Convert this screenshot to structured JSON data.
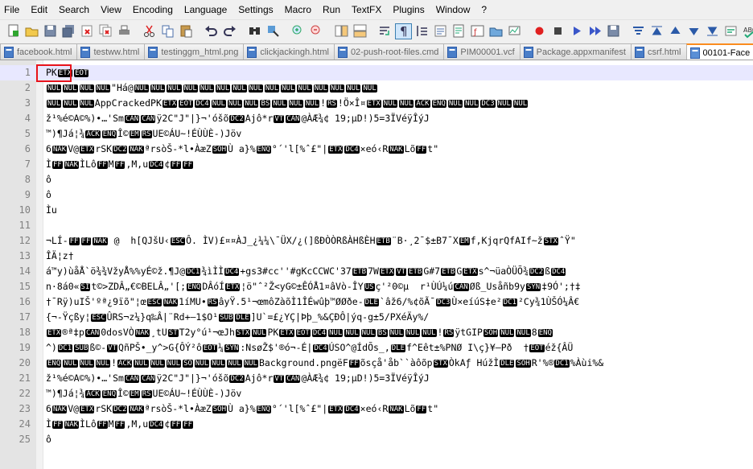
{
  "menu": [
    "File",
    "Edit",
    "Search",
    "View",
    "Encoding",
    "Language",
    "Settings",
    "Macro",
    "Run",
    "TextFX",
    "Plugins",
    "Window",
    "?"
  ],
  "toolbar_icons": [
    "new-file-icon",
    "open-file-icon",
    "save-icon",
    "save-all-icon",
    "close-icon",
    "close-all-icon",
    "print-icon",
    "cut-icon",
    "copy-icon",
    "paste-icon",
    "undo-icon",
    "redo-icon",
    "find-icon",
    "replace-icon",
    "zoom-in-icon",
    "zoom-out-icon",
    "sync-vertical-icon",
    "sync-horizontal-icon",
    "word-wrap-icon",
    "show-all-chars-icon",
    "indent-guide-icon",
    "user-lang-icon",
    "doc-map-icon",
    "function-list-icon",
    "folder-workspace-icon",
    "monitoring-icon",
    "record-macro-icon",
    "stop-macro-icon",
    "play-macro-icon",
    "run-macro-multiple-icon",
    "save-macro-icon",
    "trim-icon",
    "collapse-icon",
    "move-up-icon",
    "move-down-icon",
    "expand-icon",
    "select-icon",
    "spell-check-icon"
  ],
  "tabs": [
    {
      "label": "facebook.html"
    },
    {
      "label": "testww.html"
    },
    {
      "label": "testinggm_html.png"
    },
    {
      "label": "clickjackingh.html"
    },
    {
      "label": "02-push-root-files.cmd"
    },
    {
      "label": "PIM00001.vcf"
    },
    {
      "label": "Package.appxmanifest"
    },
    {
      "label": "csrf.html"
    },
    {
      "label": "00101-Face"
    }
  ],
  "active_tab": 8,
  "lines": [
    [
      [
        "t",
        "PK"
      ],
      [
        "c",
        "ETX"
      ],
      [
        "c",
        "EOT"
      ]
    ],
    [
      [
        "c",
        "NUL"
      ],
      [
        "c",
        "NUL"
      ],
      [
        "c",
        "NUL"
      ],
      [
        "c",
        "NUL"
      ],
      [
        "t",
        "\"Há@"
      ],
      [
        "c",
        "NUL"
      ],
      [
        "c",
        "NUL"
      ],
      [
        "c",
        "NUL"
      ],
      [
        "c",
        "NUL"
      ],
      [
        "c",
        "NUL"
      ],
      [
        "c",
        "NUL"
      ],
      [
        "c",
        "NUL"
      ],
      [
        "c",
        "NUL"
      ],
      [
        "c",
        "NUL"
      ],
      [
        "c",
        "NUL"
      ],
      [
        "c",
        "NUL"
      ],
      [
        "c",
        "NUL"
      ],
      [
        "c",
        "NUL"
      ],
      [
        "c",
        "NUL"
      ],
      [
        "c",
        "NUL"
      ]
    ],
    [
      [
        "c",
        "NUL"
      ],
      [
        "c",
        "NUL"
      ],
      [
        "c",
        "NUL"
      ],
      [
        "t",
        "AppCrackedPK"
      ],
      [
        "c",
        "ETX"
      ],
      [
        "c",
        "EOT"
      ],
      [
        "c",
        "DC4"
      ],
      [
        "c",
        "NUL"
      ],
      [
        "c",
        "NUL"
      ],
      [
        "c",
        "NUL"
      ],
      [
        "c",
        "BS"
      ],
      [
        "c",
        "NUL"
      ],
      [
        "c",
        "NUL"
      ],
      [
        "c",
        "NUL"
      ],
      [
        "t",
        "!"
      ],
      [
        "c",
        "RS"
      ],
      [
        "t",
        "!Ö×Î¤"
      ],
      [
        "c",
        "ETX"
      ],
      [
        "c",
        "NUL"
      ],
      [
        "c",
        "NUL"
      ],
      [
        "c",
        "ACK"
      ],
      [
        "c",
        "ENQ"
      ],
      [
        "c",
        "NUL"
      ],
      [
        "c",
        "NUL"
      ],
      [
        "c",
        "DC3"
      ],
      [
        "c",
        "NUL"
      ],
      [
        "c",
        "NUL"
      ]
    ],
    [
      [
        "t",
        "ž¹%é©A©%)•…'Sm"
      ],
      [
        "c",
        "CAN"
      ],
      [
        "c",
        "CAN"
      ],
      [
        "t",
        "ÿ2C\"J\"|}¬'óšõ"
      ],
      [
        "c",
        "DC2"
      ],
      [
        "t",
        "Ajô*r"
      ],
      [
        "c",
        "VT"
      ],
      [
        "c",
        "CAN"
      ],
      [
        "t",
        "@ÀÆ¾¢ 19;µD!)5=3ÏVéÿÎýJ"
      ]
    ],
    [
      [
        "t",
        "™)¶Já¦¾"
      ],
      [
        "c",
        "ACK"
      ],
      [
        "c",
        "ENQ"
      ],
      [
        "t",
        "Î©"
      ],
      [
        "c",
        "EM"
      ],
      [
        "c",
        "RS"
      ],
      [
        "t",
        "UE©ÁU~!ÉÙÙÈ-)Jöv"
      ]
    ],
    [
      [
        "t",
        "6"
      ],
      [
        "c",
        "NAK"
      ],
      [
        "t",
        "V@"
      ],
      [
        "c",
        "ETX"
      ],
      [
        "t",
        "rSK"
      ],
      [
        "c",
        "DC2"
      ],
      [
        "c",
        "NAK"
      ],
      [
        "t",
        "ªrsòŠ-*l•ÀæZ"
      ],
      [
        "c",
        "SOH"
      ],
      [
        "t",
        "Ù a}%"
      ],
      [
        "c",
        "ENQ"
      ],
      [
        "t",
        "°´'l[%ˆ£\"|"
      ],
      [
        "c",
        "ETX"
      ],
      [
        "c",
        "DC4"
      ],
      [
        "t",
        "×eó‹R"
      ],
      [
        "c",
        "NAK"
      ],
      [
        "t",
        "Lõ"
      ],
      [
        "c",
        "FF"
      ],
      [
        "t",
        "t\""
      ]
    ],
    [
      [
        "t",
        "Ì"
      ],
      [
        "c",
        "FF"
      ],
      [
        "c",
        "NAK"
      ],
      [
        "t",
        "ÌLô"
      ],
      [
        "c",
        "FF"
      ],
      [
        "t",
        "M"
      ],
      [
        "c",
        "FF"
      ],
      [
        "t",
        ",M,u"
      ],
      [
        "c",
        "DC4"
      ],
      [
        "t",
        "¢"
      ],
      [
        "c",
        "FF"
      ],
      [
        "c",
        "FF"
      ]
    ],
    [
      [
        "t",
        "ô"
      ]
    ],
    [
      [
        "t",
        "ô"
      ]
    ],
    [
      [
        "t",
        "Ìu"
      ]
    ],
    [],
    [
      [
        "t",
        "¬LÍ-"
      ],
      [
        "c",
        "FF"
      ],
      [
        "c",
        "FF"
      ],
      [
        "c",
        "NAK"
      ],
      [
        "t",
        " @  h[QJšU‹"
      ],
      [
        "c",
        "ESC"
      ],
      [
        "t",
        "Ô. ÌV)£¤¤ÀJ_¿¼¼\\¯ÜX/¿(]ßÐÒÒRßÀHßÈH"
      ],
      [
        "c",
        "ETB"
      ],
      [
        "t",
        "¨B·¸2¯$±B7¯X"
      ],
      [
        "c",
        "EM"
      ],
      [
        "t",
        "f,KjqrQfAIf~ž"
      ],
      [
        "c",
        "STX"
      ],
      [
        "t",
        "ˆŸ\""
      ]
    ],
    [
      [
        "t",
        "ÎÄ¦z†"
      ]
    ],
    [
      [
        "t",
        "á™y)ùåÅ`ö¾¾VžyÅ%%yÉ©ž.¶J@"
      ],
      [
        "c",
        "DC1"
      ],
      [
        "t",
        "¾ìÌÌ"
      ],
      [
        "c",
        "DC4"
      ],
      [
        "t",
        "+gs3#cc''#gKcCCWC'37"
      ],
      [
        "c",
        "ETB"
      ],
      [
        "t",
        "7W"
      ],
      [
        "c",
        "ETX"
      ],
      [
        "c",
        "VT"
      ],
      [
        "c",
        "ETB"
      ],
      [
        "t",
        "G#7"
      ],
      [
        "c",
        "ETB"
      ],
      [
        "t",
        "G"
      ],
      [
        "c",
        "ETX"
      ],
      [
        "t",
        "s^¬üaÒÜÕ¾"
      ],
      [
        "c",
        "DC2"
      ],
      [
        "t",
        "ß"
      ],
      [
        "c",
        "DC4"
      ]
    ],
    [
      [
        "t",
        "n·8á0«"
      ],
      [
        "c",
        "SI"
      ],
      [
        "t",
        "t©>ZDÂ„€©BELÂ„'[;"
      ],
      [
        "c",
        "ENQ"
      ],
      [
        "t",
        "DÂóÍ"
      ],
      [
        "c",
        "ETX"
      ],
      [
        "t",
        "¦ö\"ˆ²Ž<yG©±ÊÓÅ1¤âVò-ÎY"
      ],
      [
        "c",
        "US"
      ],
      [
        "t",
        "ç'²0©µ  r¹ÙÚ¼ú"
      ],
      [
        "c",
        "CAN"
      ],
      [
        "t",
        "Øß_Usåñb9y"
      ],
      [
        "c",
        "SYN"
      ],
      [
        "t",
        "‡9Ó';†‡"
      ]
    ],
    [
      [
        "t",
        "†¯Rÿ)uIŠ'ºª¿9ïõ\"¦œ"
      ],
      [
        "c",
        "ESC"
      ],
      [
        "c",
        "NAK"
      ],
      [
        "t",
        "1íMU•"
      ],
      [
        "c",
        "RS"
      ],
      [
        "t",
        "âyŸ.5¹¬œmôZàõÌ1ÎÉwûþ™ØØðe-"
      ],
      [
        "c",
        "DLE"
      ],
      [
        "t",
        "`âž6/%¢õÃ¯"
      ],
      [
        "c",
        "DC3"
      ],
      [
        "t",
        "Ù×eíúS‡e²"
      ],
      [
        "c",
        "DC1"
      ],
      [
        "t",
        "²Cy¾1ÙŠÓ¼Â€"
      ]
    ],
    [
      [
        "t",
        "{¬-Ÿçßy¦"
      ],
      [
        "c",
        "ESC"
      ],
      [
        "t",
        "ÛRS¬z¼}q‰Â|¨Rd+—1$O¹"
      ],
      [
        "c",
        "SUB"
      ],
      [
        "c",
        "DLE"
      ],
      [
        "t",
        "]U`=£¿YÇ|Þþ_%&ÇÐÔ|ýq-g±5/PXéÄy%/"
      ]
    ],
    [
      [
        "c",
        "ETX"
      ],
      [
        "t",
        "®ª‡p"
      ],
      [
        "c",
        "CAN"
      ],
      [
        "t",
        "0dosVÒ"
      ],
      [
        "c",
        "NAK"
      ],
      [
        "t",
        "¸tU"
      ],
      [
        "c",
        "ST"
      ],
      [
        "t",
        "T2y°ú¹¬œJh"
      ],
      [
        "c",
        "STX"
      ],
      [
        "c",
        "NUL"
      ],
      [
        "t",
        "PK"
      ],
      [
        "c",
        "ETX"
      ],
      [
        "c",
        "EOT"
      ],
      [
        "c",
        "DC4"
      ],
      [
        "c",
        "NUL"
      ],
      [
        "c",
        "NUL"
      ],
      [
        "c",
        "NUL"
      ],
      [
        "c",
        "BS"
      ],
      [
        "c",
        "NUL"
      ],
      [
        "c",
        "NUL"
      ],
      [
        "c",
        "NUL"
      ],
      [
        "t",
        "!"
      ],
      [
        "c",
        "RS"
      ],
      [
        "t",
        "ÿtGIP"
      ],
      [
        "c",
        "SOH"
      ],
      [
        "c",
        "NUL"
      ],
      [
        "c",
        "NUL"
      ],
      [
        "t",
        "8"
      ],
      [
        "c",
        "ENQ"
      ]
    ],
    [
      [
        "t",
        "^)"
      ],
      [
        "c",
        "DC1"
      ],
      [
        "c",
        "SUB"
      ],
      [
        "t",
        "ß©-"
      ],
      [
        "c",
        "VT"
      ],
      [
        "t",
        "QñPŠ•_y^>G{ÔÝ²ô"
      ],
      [
        "c",
        "EOT"
      ],
      [
        "t",
        "¼"
      ],
      [
        "c",
        "SYN"
      ],
      [
        "t",
        ":NsøŽ$'®ó¬-É|"
      ],
      [
        "c",
        "DC4"
      ],
      [
        "t",
        "ÚSO^@ÍdÕs_,"
      ],
      [
        "c",
        "DLE"
      ],
      [
        "t",
        "f^Eêt±%PNØ I\\ç}¥–Pð  †"
      ],
      [
        "c",
        "EOT"
      ],
      [
        "t",
        "éž{ÂÜ"
      ]
    ],
    [
      [
        "c",
        "ENQ"
      ],
      [
        "c",
        "NUL"
      ],
      [
        "c",
        "NUL"
      ],
      [
        "c",
        "NUL"
      ],
      [
        "t",
        "!"
      ],
      [
        "c",
        "ACK"
      ],
      [
        "c",
        "NUL"
      ],
      [
        "c",
        "NUL"
      ],
      [
        "c",
        "NUL"
      ],
      [
        "c",
        "SO"
      ],
      [
        "c",
        "NUL"
      ],
      [
        "c",
        "NUL"
      ],
      [
        "c",
        "NUL"
      ],
      [
        "c",
        "NUL"
      ],
      [
        "t",
        "Background.pngëF"
      ],
      [
        "c",
        "FF"
      ],
      [
        "t",
        "õsçå'åb``àôõp"
      ],
      [
        "c",
        "STX"
      ],
      [
        "t",
        "ÒkAƒ HúžÌ"
      ],
      [
        "c",
        "DLE"
      ],
      [
        "c",
        "SOH"
      ],
      [
        "t",
        "R'%®"
      ],
      [
        "c",
        "DC1"
      ],
      [
        "t",
        "%Àùi%&"
      ]
    ],
    [
      [
        "t",
        "ž¹%é©A©%)•…'Sm"
      ],
      [
        "c",
        "CAN"
      ],
      [
        "c",
        "CAN"
      ],
      [
        "t",
        "ÿ2C\"J\"|}¬'óšõ"
      ],
      [
        "c",
        "DC2"
      ],
      [
        "t",
        "Ajô*r"
      ],
      [
        "c",
        "VT"
      ],
      [
        "c",
        "CAN"
      ],
      [
        "t",
        "@ÀÆ¾¢ 19;µD!)5=3ÏVéÿÎýJ"
      ]
    ],
    [
      [
        "t",
        "™)¶Já¦¾"
      ],
      [
        "c",
        "ACK"
      ],
      [
        "c",
        "ENQ"
      ],
      [
        "t",
        "Î©"
      ],
      [
        "c",
        "EM"
      ],
      [
        "c",
        "RS"
      ],
      [
        "t",
        "UE©ÁU~!ÉÙÙÈ-)Jöv"
      ]
    ],
    [
      [
        "t",
        "6"
      ],
      [
        "c",
        "NAK"
      ],
      [
        "t",
        "V@"
      ],
      [
        "c",
        "ETX"
      ],
      [
        "t",
        "rSK"
      ],
      [
        "c",
        "DC2"
      ],
      [
        "c",
        "NAK"
      ],
      [
        "t",
        "ªrsòŠ-*l•ÀæZ"
      ],
      [
        "c",
        "SOH"
      ],
      [
        "t",
        "Ù a}%"
      ],
      [
        "c",
        "ENQ"
      ],
      [
        "t",
        "°´'l[%ˆ£\"|"
      ],
      [
        "c",
        "ETX"
      ],
      [
        "c",
        "DC4"
      ],
      [
        "t",
        "×eó‹R"
      ],
      [
        "c",
        "NAK"
      ],
      [
        "t",
        "Lõ"
      ],
      [
        "c",
        "FF"
      ],
      [
        "t",
        "t\""
      ]
    ],
    [
      [
        "t",
        "Ì"
      ],
      [
        "c",
        "FF"
      ],
      [
        "c",
        "NAK"
      ],
      [
        "t",
        "ÌLô"
      ],
      [
        "c",
        "FF"
      ],
      [
        "t",
        "M"
      ],
      [
        "c",
        "FF"
      ],
      [
        "t",
        ",M,u"
      ],
      [
        "c",
        "DC4"
      ],
      [
        "t",
        "¢"
      ],
      [
        "c",
        "FF"
      ],
      [
        "c",
        "FF"
      ]
    ],
    [
      [
        "t",
        "ô"
      ]
    ]
  ],
  "current_line": 1,
  "highlight_color": "#e8131b"
}
